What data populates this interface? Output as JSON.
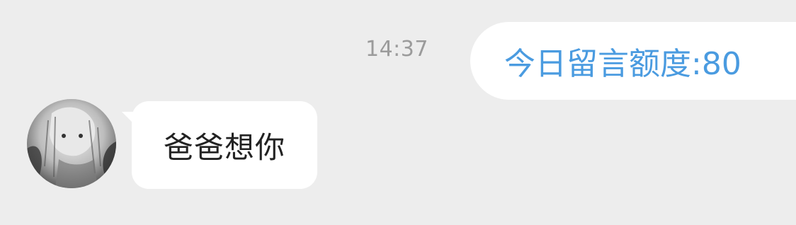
{
  "chat": {
    "timestamp": "14:37",
    "messages": [
      {
        "direction": "outgoing",
        "text": "今日留言额度:80",
        "text_color": "#4a9be0",
        "bubble_color": "#ffffff"
      },
      {
        "direction": "incoming",
        "text": "爸爸想你",
        "text_color": "#222222",
        "bubble_color": "#ffffff"
      }
    ]
  },
  "colors": {
    "background": "#ededed",
    "timestamp": "#9b9b9b"
  }
}
